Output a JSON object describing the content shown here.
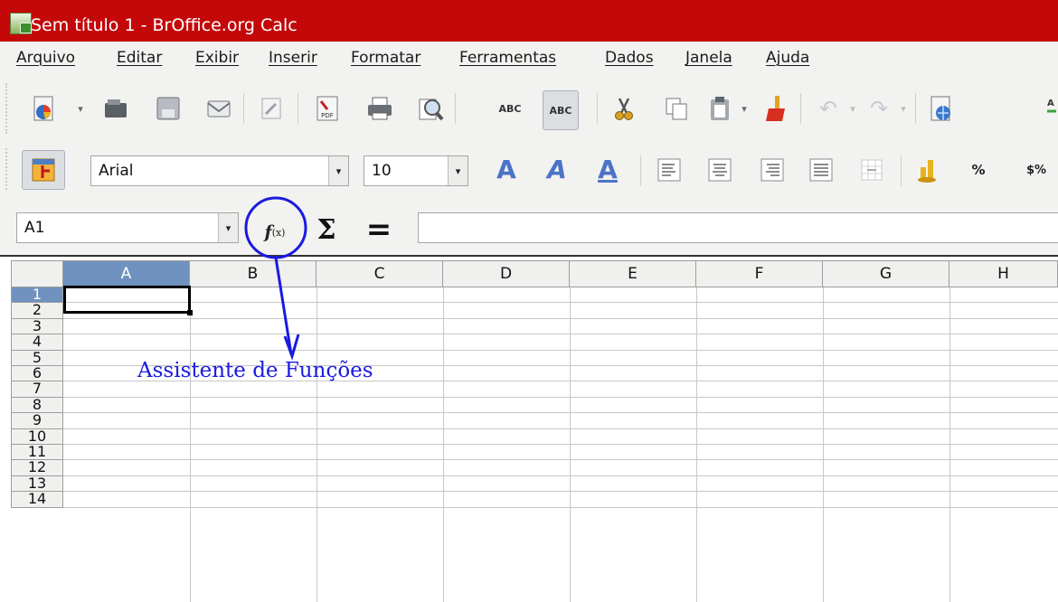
{
  "window": {
    "title": "Sem título 1 - BrOffice.org Calc"
  },
  "menu": [
    {
      "label": "Arquivo"
    },
    {
      "label": "Editar"
    },
    {
      "label": "Exibir"
    },
    {
      "label": "Inserir"
    },
    {
      "label": "Formatar"
    },
    {
      "label": "Ferramentas"
    },
    {
      "label": "Dados"
    },
    {
      "label": "Janela"
    },
    {
      "label": "Ajuda"
    }
  ],
  "toolbar_standard": {
    "icons": [
      "new-document-icon",
      "open-icon",
      "save-icon",
      "email-icon",
      "edit-file-icon",
      "export-pdf-icon",
      "print-icon",
      "print-preview-icon",
      "spellcheck-icon",
      "autospellcheck-icon",
      "cut-icon",
      "copy-icon",
      "paste-icon",
      "format-paintbrush-icon",
      "undo-icon",
      "redo-icon",
      "hyperlink-icon"
    ],
    "spell_text": "ABC",
    "pdf_text": "PDF"
  },
  "toolbar_formatting": {
    "font_name": "Arial",
    "font_size": "10",
    "bold_glyph": "A",
    "italic_glyph": "A",
    "underline_glyph": "A",
    "percent_text": "%",
    "currency_text": "$%"
  },
  "formula_bar": {
    "name_box": "A1",
    "fx_main": "f",
    "fx_small": "(x)",
    "sum_symbol": "Σ",
    "equals_symbol": "=",
    "formula_value": ""
  },
  "sheet": {
    "columns": [
      "A",
      "B",
      "C",
      "D",
      "E",
      "F",
      "G",
      "H"
    ],
    "rows": [
      "1",
      "2",
      "3",
      "4",
      "5",
      "6",
      "7",
      "8",
      "9",
      "10",
      "11",
      "12",
      "13",
      "14"
    ],
    "selected_cell": "A1"
  },
  "annotation": {
    "label": "Assistente de Funções",
    "color": "#1a1ae0"
  }
}
